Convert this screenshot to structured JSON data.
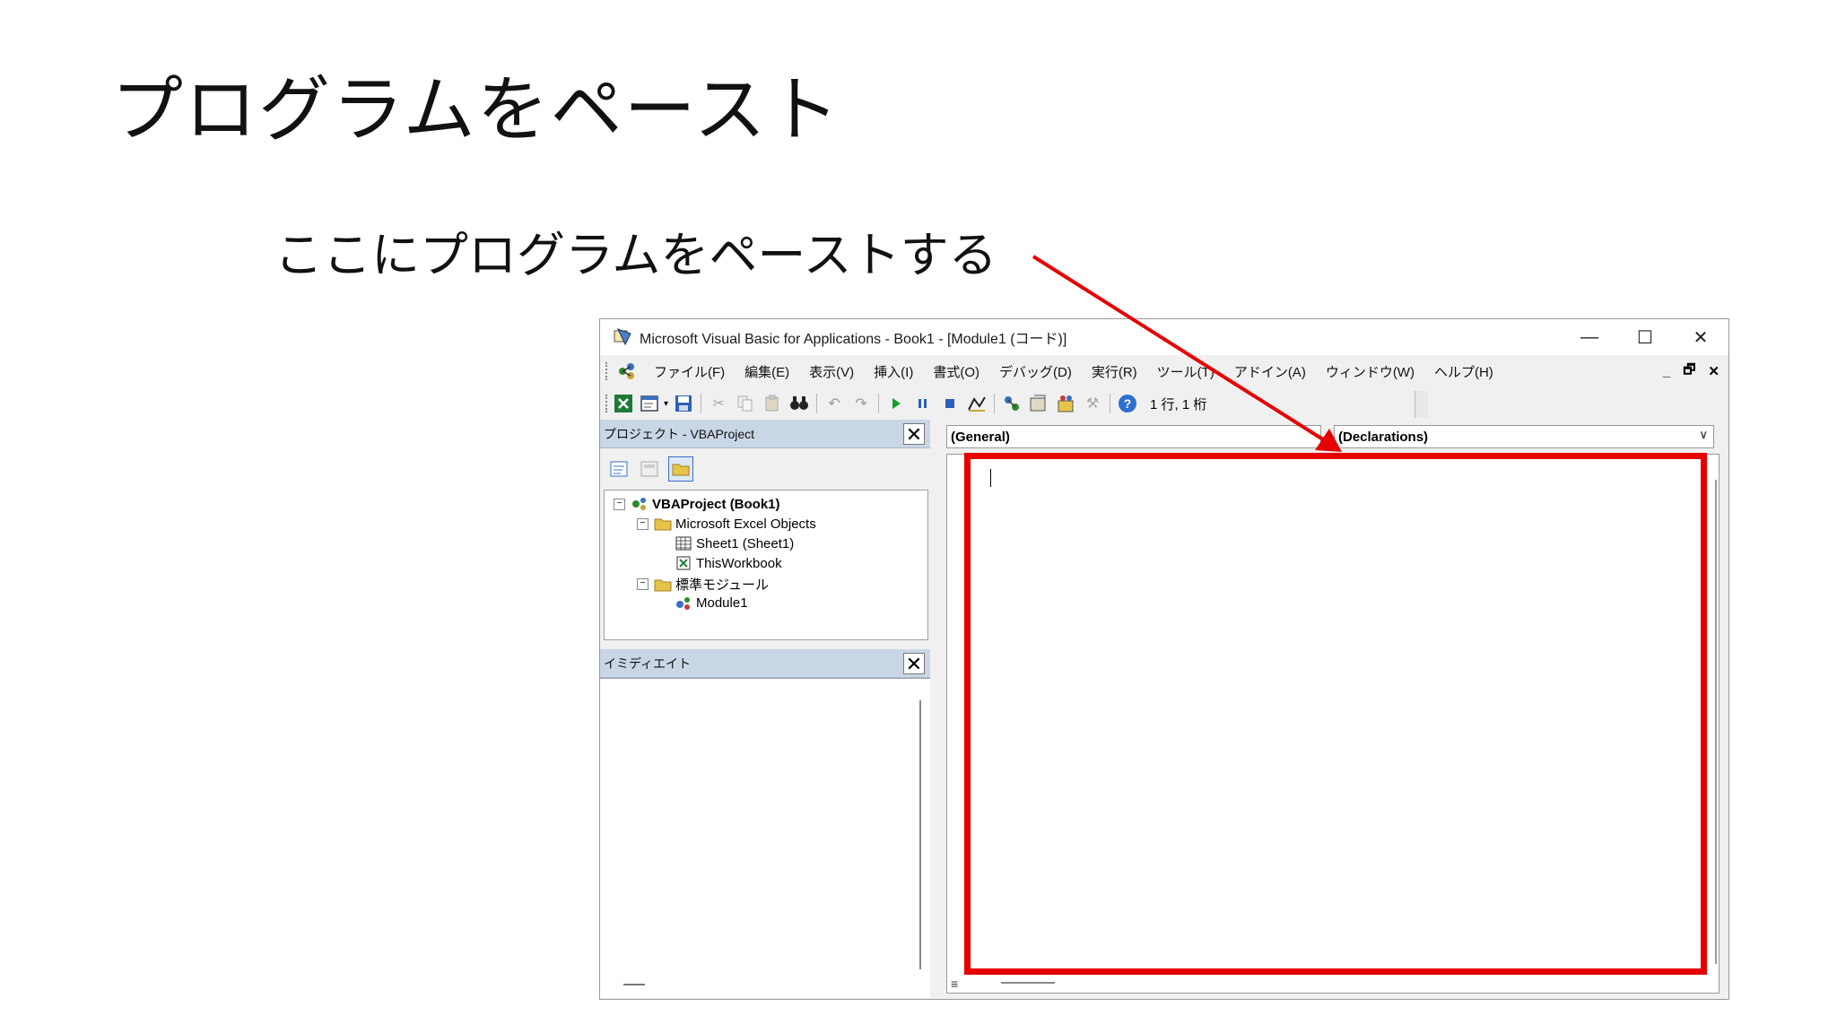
{
  "slide": {
    "title": "プログラムをペースト",
    "annotation": "ここにプログラムをペーストする"
  },
  "window": {
    "title": "Microsoft Visual Basic for Applications - Book1 - [Module1 (コード)]",
    "controls": {
      "minimize": "—",
      "maximize": "☐",
      "close": "✕"
    },
    "mdi_controls": {
      "minimize": "_",
      "restore": "🗗",
      "close": "✕"
    }
  },
  "menu": {
    "items": [
      "ファイル(F)",
      "編集(E)",
      "表示(V)",
      "挿入(I)",
      "書式(O)",
      "デバッグ(D)",
      "実行(R)",
      "ツール(T)",
      "アドイン(A)",
      "ウィンドウ(W)",
      "ヘルプ(H)"
    ]
  },
  "toolbar": {
    "position_status": "1 行, 1 桁"
  },
  "project_panel": {
    "title": "プロジェクト - VBAProject",
    "close": "✕",
    "tree": {
      "root": "VBAProject (Book1)",
      "excel_objects": "Microsoft Excel Objects",
      "sheet1": "Sheet1 (Sheet1)",
      "workbook": "ThisWorkbook",
      "modules": "標準モジュール",
      "module1": "Module1"
    }
  },
  "immediate_panel": {
    "title": "イミディエイト",
    "close": "✕"
  },
  "code_pane": {
    "object_combo": "(General)",
    "proc_combo": "(Declarations)",
    "combo_arrow": "∨",
    "footer_icon": "≡"
  },
  "colors": {
    "highlight": "#e60000",
    "panel_header": "#c9d6e6"
  }
}
